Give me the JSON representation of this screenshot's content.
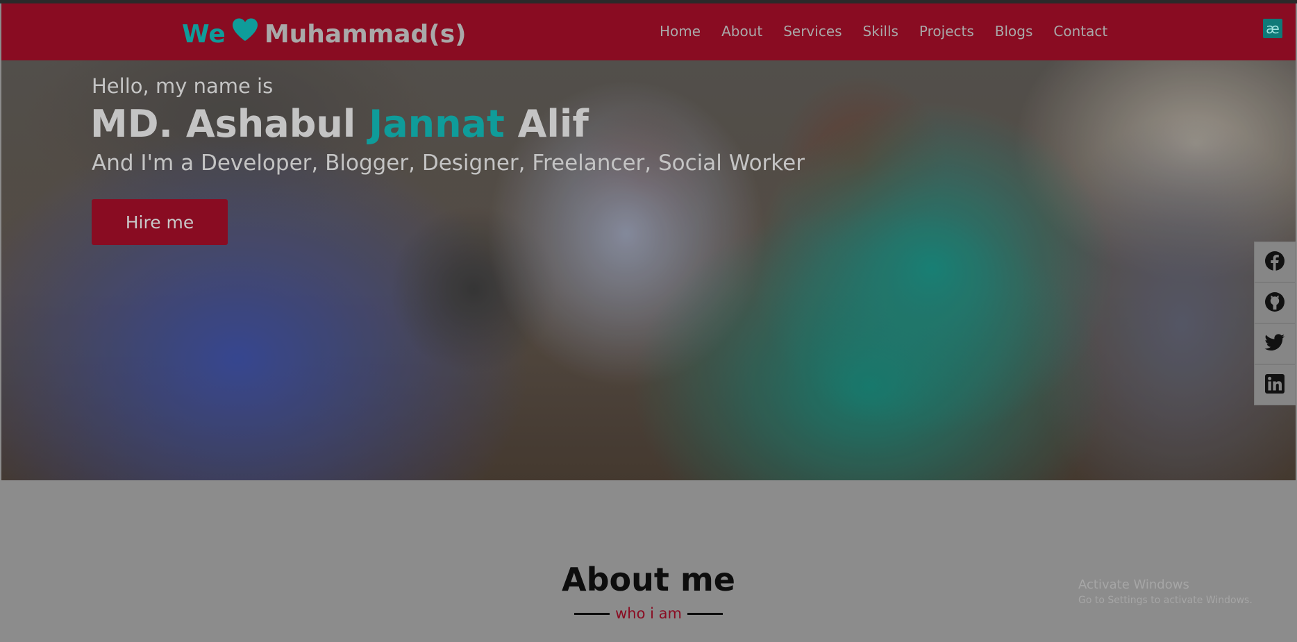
{
  "brand": {
    "we": "We",
    "heart": "heart-icon",
    "name": "Muhammad(s)"
  },
  "nav": {
    "items": [
      {
        "label": "Home"
      },
      {
        "label": "About"
      },
      {
        "label": "Services"
      },
      {
        "label": "Skills"
      },
      {
        "label": "Projects"
      },
      {
        "label": "Blogs"
      },
      {
        "label": "Contact"
      }
    ],
    "badge": "æ"
  },
  "hero": {
    "greeting": "Hello, my name is",
    "name_first": "MD. Ashabul",
    "name_accent": "Jannat",
    "name_last": "Alif",
    "roles": "And I'm a Developer, Blogger, Designer, Freelancer, Social Worker",
    "cta": "Hire me"
  },
  "social": [
    "facebook-icon",
    "github-icon",
    "twitter-icon",
    "linkedin-icon"
  ],
  "about": {
    "title": "About me",
    "subtitle": "who i am"
  },
  "watermark": {
    "line1": "Activate Windows",
    "line2": "Go to Settings to activate Windows."
  },
  "colors": {
    "brand_red": "#890c22",
    "accent_teal": "#0f9c9a",
    "page_bg": "#8c8c8c"
  }
}
